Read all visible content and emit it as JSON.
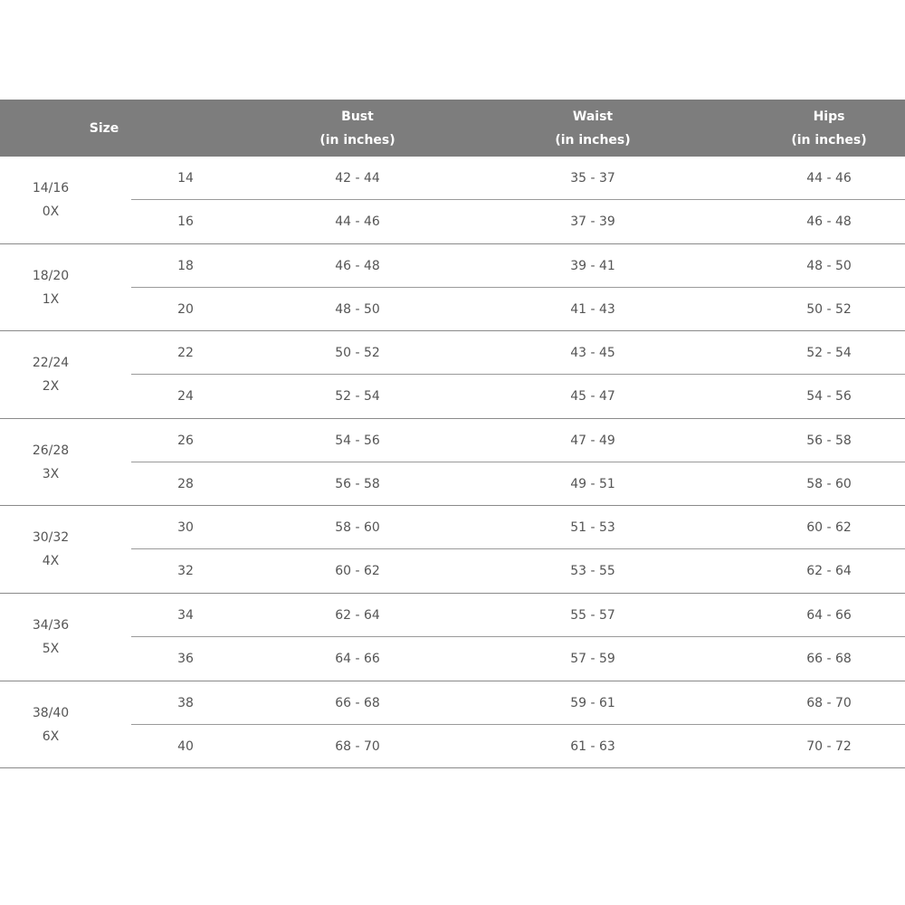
{
  "header": {
    "size": "Size",
    "bust_line1": "Bust",
    "bust_line2": "(in inches)",
    "waist_line1": "Waist",
    "waist_line2": "(in inches)",
    "hips_line1": "Hips",
    "hips_line2": "(in inches)"
  },
  "groups": [
    {
      "label1": "14/16",
      "label2": "0X",
      "rows": [
        {
          "size": "14",
          "bust": "42 - 44",
          "waist": "35 - 37",
          "hips": "44 - 46"
        },
        {
          "size": "16",
          "bust": "44 - 46",
          "waist": "37 - 39",
          "hips": "46 - 48"
        }
      ]
    },
    {
      "label1": "18/20",
      "label2": "1X",
      "rows": [
        {
          "size": "18",
          "bust": "46 - 48",
          "waist": "39 - 41",
          "hips": "48 - 50"
        },
        {
          "size": "20",
          "bust": "48 - 50",
          "waist": "41 - 43",
          "hips": "50 - 52"
        }
      ]
    },
    {
      "label1": "22/24",
      "label2": "2X",
      "rows": [
        {
          "size": "22",
          "bust": "50 - 52",
          "waist": "43 - 45",
          "hips": "52 - 54"
        },
        {
          "size": "24",
          "bust": "52 - 54",
          "waist": "45 - 47",
          "hips": "54 - 56"
        }
      ]
    },
    {
      "label1": "26/28",
      "label2": "3X",
      "rows": [
        {
          "size": "26",
          "bust": "54 - 56",
          "waist": "47 - 49",
          "hips": "56 - 58"
        },
        {
          "size": "28",
          "bust": "56 - 58",
          "waist": "49 - 51",
          "hips": "58 - 60"
        }
      ]
    },
    {
      "label1": "30/32",
      "label2": "4X",
      "rows": [
        {
          "size": "30",
          "bust": "58 - 60",
          "waist": "51 - 53",
          "hips": "60 - 62"
        },
        {
          "size": "32",
          "bust": "60 - 62",
          "waist": "53 - 55",
          "hips": "62 - 64"
        }
      ]
    },
    {
      "label1": "34/36",
      "label2": "5X",
      "rows": [
        {
          "size": "34",
          "bust": "62 - 64",
          "waist": "55 - 57",
          "hips": "64 - 66"
        },
        {
          "size": "36",
          "bust": "64 - 66",
          "waist": "57 - 59",
          "hips": "66 - 68"
        }
      ]
    },
    {
      "label1": "38/40",
      "label2": "6X",
      "rows": [
        {
          "size": "38",
          "bust": "66 - 68",
          "waist": "59 - 61",
          "hips": "68 - 70"
        },
        {
          "size": "40",
          "bust": "68 - 70",
          "waist": "61 - 63",
          "hips": "70 - 72"
        }
      ]
    }
  ]
}
